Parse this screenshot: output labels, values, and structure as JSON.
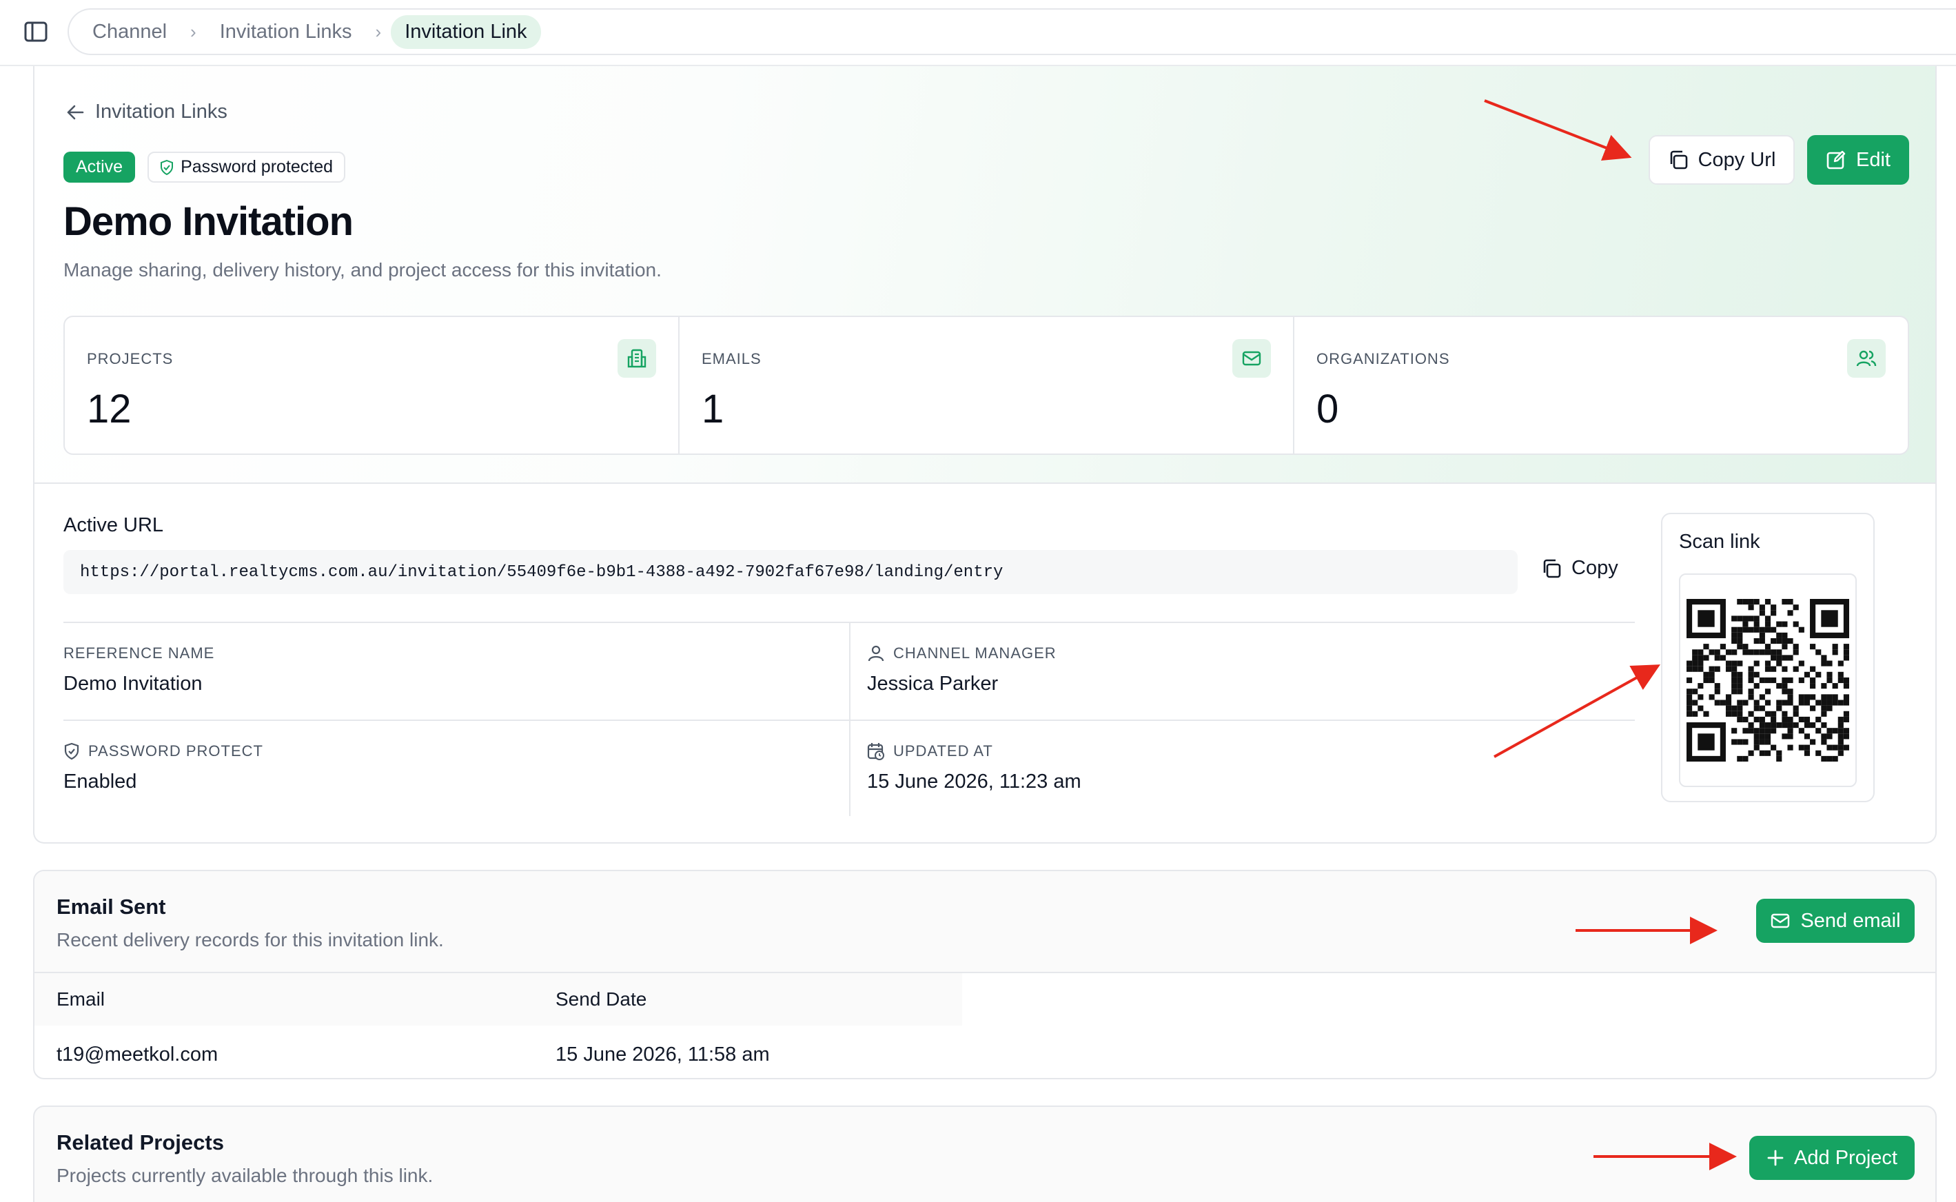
{
  "breadcrumb": {
    "items": [
      "Channel",
      "Invitation Links"
    ],
    "current": "Invitation Link"
  },
  "header": {
    "back_label": "Invitation Links",
    "status_badge": "Active",
    "password_badge": "Password protected",
    "title": "Demo Invitation",
    "subtitle": "Manage sharing, delivery history, and project access for this invitation.",
    "copy_url_label": "Copy Url",
    "edit_label": "Edit"
  },
  "stats": [
    {
      "label": "PROJECTS",
      "value": "12",
      "icon": "building-icon"
    },
    {
      "label": "EMAILS",
      "value": "1",
      "icon": "mail-icon"
    },
    {
      "label": "ORGANIZATIONS",
      "value": "0",
      "icon": "users-icon"
    }
  ],
  "active_url": {
    "label": "Active URL",
    "value": "https://portal.realtycms.com.au/invitation/55409f6e-b9b1-4388-a492-7902faf67e98/landing/entry",
    "copy_label": "Copy"
  },
  "details": {
    "reference_name": {
      "label": "REFERENCE NAME",
      "value": "Demo Invitation"
    },
    "channel_manager": {
      "label": "CHANNEL MANAGER",
      "value": "Jessica Parker"
    },
    "password_protect": {
      "label": "PASSWORD PROTECT",
      "value": "Enabled"
    },
    "updated_at": {
      "label": "UPDATED AT",
      "value": "15 June 2026, 11:23 am"
    }
  },
  "scan": {
    "title": "Scan link"
  },
  "email_sent": {
    "title": "Email Sent",
    "subtitle": "Recent delivery records for this invitation link.",
    "button_label": "Send email",
    "columns": [
      "Email",
      "Send Date"
    ],
    "rows": [
      {
        "email": "t19@meetkol.com",
        "send_date": "15 June 2026, 11:58 am"
      }
    ]
  },
  "related_projects": {
    "title": "Related Projects",
    "subtitle": "Projects currently available through this link.",
    "button_label": "Add Project"
  },
  "colors": {
    "accent": "#16a362",
    "accent_soft": "#e3f4ea",
    "annotation_arrow": "#e8281c"
  }
}
